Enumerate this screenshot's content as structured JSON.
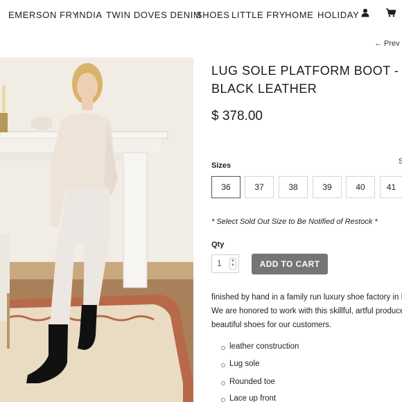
{
  "nav": {
    "items": [
      "EMERSON FRY",
      "INDIA",
      "TWIN DOVES DENIM",
      "SHOES",
      "LITTLE FRY",
      "HOME",
      "HOLIDAY"
    ],
    "account_icon": "user-icon",
    "cart_icon": "cart-icon"
  },
  "prev_link": "← Prev",
  "product": {
    "title_line1": "LUG SOLE PLATFORM BOOT -",
    "title_line2": "BLACK LEATHER",
    "price": "$ 378.00",
    "photo": "product-photo-model-wearing-boots"
  },
  "sizes": {
    "label": "Sizes",
    "guide_label": "S",
    "options": [
      "36",
      "37",
      "38",
      "39",
      "40",
      "41"
    ],
    "selected": "36"
  },
  "restock_note": "* Select Sold Out Size to Be Notified of Restock *",
  "quantity": {
    "label": "Qty",
    "value": "1"
  },
  "add_to_cart_label": "ADD TO CART",
  "description": [
    "finished by hand in a family run luxury shoe factory in Po",
    "We are honored to work with this skillful, artful producer",
    "beautiful shoes for our customers."
  ],
  "features": [
    "leather construction",
    "Lug sole",
    "Rounded toe",
    "Lace up front"
  ],
  "colors": {
    "button": "#757575",
    "text": "#222222"
  }
}
